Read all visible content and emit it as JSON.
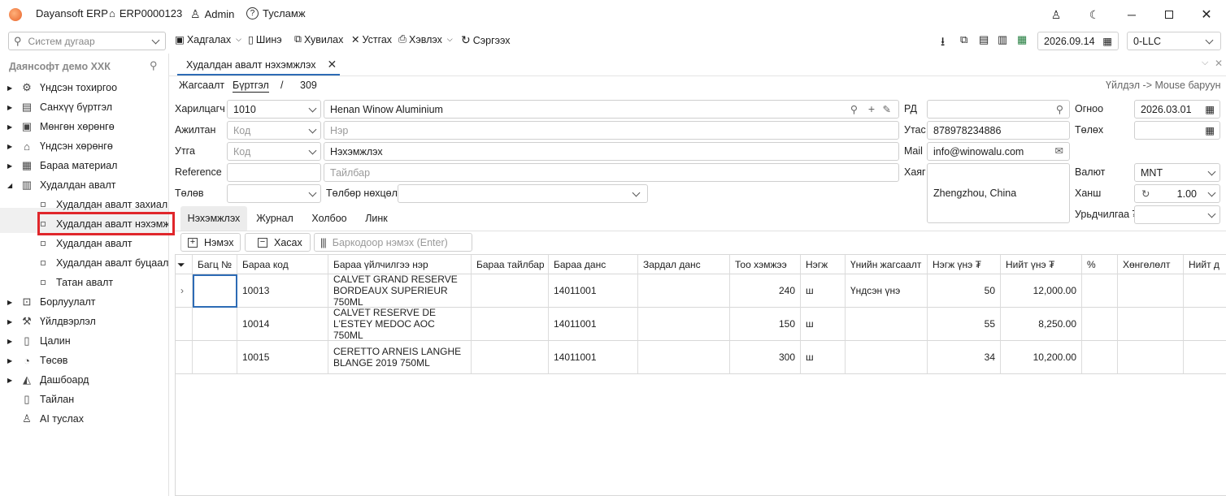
{
  "titlebar": {
    "app_name": "Dayansoft ERP",
    "record_code": "ERP0000123",
    "user": "Admin",
    "help": "Тусламж"
  },
  "toolbar": {
    "search_placeholder": "Систем дугаар",
    "save": "Хадгалах",
    "new": "Шинэ",
    "copy": "Хувилах",
    "delete": "Устгах",
    "print": "Хэвлэх",
    "refresh": "Сэргээх",
    "date": "2026.09.14",
    "company": "0-LLC"
  },
  "sidebar": {
    "org_name": "Даянсофт демо ХХК",
    "items": [
      {
        "label": "Үндсэн тохиргоо",
        "icon": "gear-icon",
        "glyph": "⚙"
      },
      {
        "label": "Санхүү бүртгэл",
        "icon": "ledger-icon",
        "glyph": "▤"
      },
      {
        "label": "Мөнгөн хөрөнгө",
        "icon": "money-icon",
        "glyph": "▣"
      },
      {
        "label": "Үндсэн хөрөнгө",
        "icon": "building-icon",
        "glyph": "⌂"
      },
      {
        "label": "Бараа материал",
        "icon": "inventory-icon",
        "glyph": "▦"
      },
      {
        "label": "Худалдан авалт",
        "icon": "purchase-icon",
        "glyph": "▥"
      }
    ],
    "subitems": [
      "Худалдан авалт захиалга",
      "Худалдан авалт нэхэмжлэх",
      "Худалдан авалт",
      "Худалдан авалт буцаалт",
      "Татан авалт"
    ],
    "items2": [
      {
        "label": "Борлуулалт",
        "icon": "cart-icon",
        "glyph": "⊡"
      },
      {
        "label": "Үйлдвэрлэл",
        "icon": "factory-icon",
        "glyph": "⚒"
      },
      {
        "label": "Цалин",
        "icon": "payroll-icon",
        "glyph": "▯"
      },
      {
        "label": "Төсөв",
        "icon": "pie-icon",
        "glyph": "◔"
      },
      {
        "label": "Дашбоард",
        "icon": "dashboard-icon",
        "glyph": "◭"
      },
      {
        "label": "Тайлан",
        "icon": "report-icon",
        "glyph": "▯"
      },
      {
        "label": "AI туслах",
        "icon": "ai-assistant-icon",
        "glyph": "♙"
      }
    ]
  },
  "doc": {
    "tab_title": "Худалдан авалт нэхэмжлэх",
    "crumb_list": "Жагсаалт",
    "crumb_register": "Бүртгэл",
    "crumb_sep": "/",
    "crumb_number": "309",
    "hint": "Үйлдэл -> Mouse баруун"
  },
  "form": {
    "partner_label": "Харилцагч",
    "partner_code": "1010",
    "partner_name": "Henan Winow Aluminium",
    "employee_label": "Ажилтан",
    "employee_code_ph": "Код",
    "employee_name_ph": "Нэр",
    "warehouse_label": "Утга",
    "warehouse_code_ph": "Код",
    "description": "Нэхэмжлэх",
    "reference_label": "Reference",
    "note_ph": "Тайлбар",
    "pay_label": "Төлөв",
    "pay_terms_label": "Төлбөр нөхцөл",
    "rd_label": "РД",
    "phone_label": "Утас",
    "phone": "878978234886",
    "mail_label": "Mail",
    "mail": "info@winowalu.com",
    "address_label": "Хаяг",
    "address": "Zhengzhou, China",
    "date_label": "Огноо",
    "date": "2026.03.01",
    "pay_date_label": "Төлөх",
    "currency_label": "Валют",
    "currency": "MNT",
    "rate_label": "Ханш",
    "rate": "1.00",
    "prepay_label": "Урьдчилгаа ₮"
  },
  "tabs": [
    "Нэхэмжлэх",
    "Журнал",
    "Холбоо",
    "Линк"
  ],
  "gridbar": {
    "add": "Нэмэх",
    "remove": "Хасах",
    "barcode_ph": "Баркодоор нэмэх (Enter)"
  },
  "grid": {
    "headers": [
      "Багц №",
      "Бараа код",
      "Бараа үйлчилгээ нэр",
      "Бараа тайлбар",
      "Бараа данс",
      "Зардал данс",
      "Тоо хэмжээ",
      "Нэгж",
      "Үнийн жагсаалт",
      "Нэгж үнэ ₮",
      "Нийт үнэ ₮",
      "%",
      "Хөнгөлөлт",
      "Нийт д"
    ],
    "rows": [
      {
        "batch": "",
        "code": "10013",
        "name": "CALVET GRAND RESERVE BORDEAUX SUPERIEUR 750ML",
        "desc": "",
        "acct": "14011001",
        "exp": "",
        "qty": "240",
        "unit": "ш",
        "pricelist": "Үндсэн үнэ",
        "price": "50",
        "total": "12,000.00"
      },
      {
        "batch": "",
        "code": "10014",
        "name": "CALVET RESERVE DE L'ESTEY MEDOC AOC 750ML",
        "desc": "",
        "acct": "14011001",
        "exp": "",
        "qty": "150",
        "unit": "ш",
        "pricelist": "",
        "price": "55",
        "total": "8,250.00"
      },
      {
        "batch": "",
        "code": "10015",
        "name": "CERETTO ARNEIS LANGHE BLANGE 2019 750ML",
        "desc": "",
        "acct": "14011001",
        "exp": "",
        "qty": "300",
        "unit": "ш",
        "pricelist": "",
        "price": "34",
        "total": "10,200.00"
      }
    ]
  },
  "colors": {
    "highlight_box": "#e0262b",
    "accent": "#2d6bb5"
  }
}
